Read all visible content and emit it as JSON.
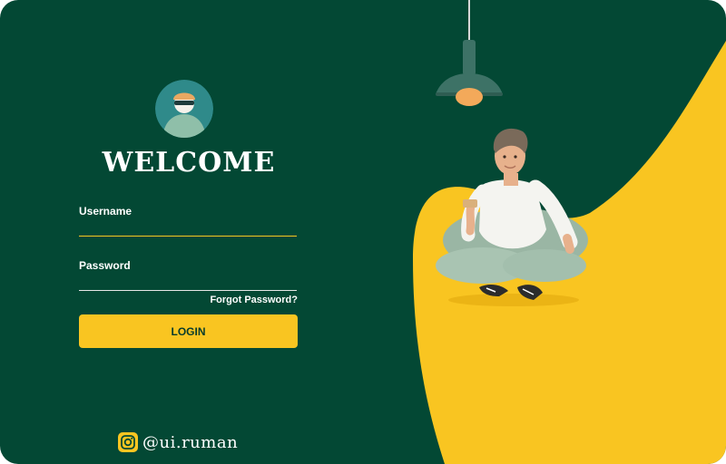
{
  "colors": {
    "background": "#034834",
    "accent": "#f9c521",
    "text": "#ffffff",
    "button_text": "#063b2c"
  },
  "header": {
    "avatar_icon": "user-avatar-icon",
    "title": "WELCOME"
  },
  "form": {
    "username_label": "Username",
    "username_value": "",
    "password_label": "Password",
    "password_value": "",
    "forgot_password": "Forgot Password?",
    "login_button": "LOGIN"
  },
  "footer": {
    "social_icon": "instagram-icon",
    "handle": "@ui.ruman"
  }
}
